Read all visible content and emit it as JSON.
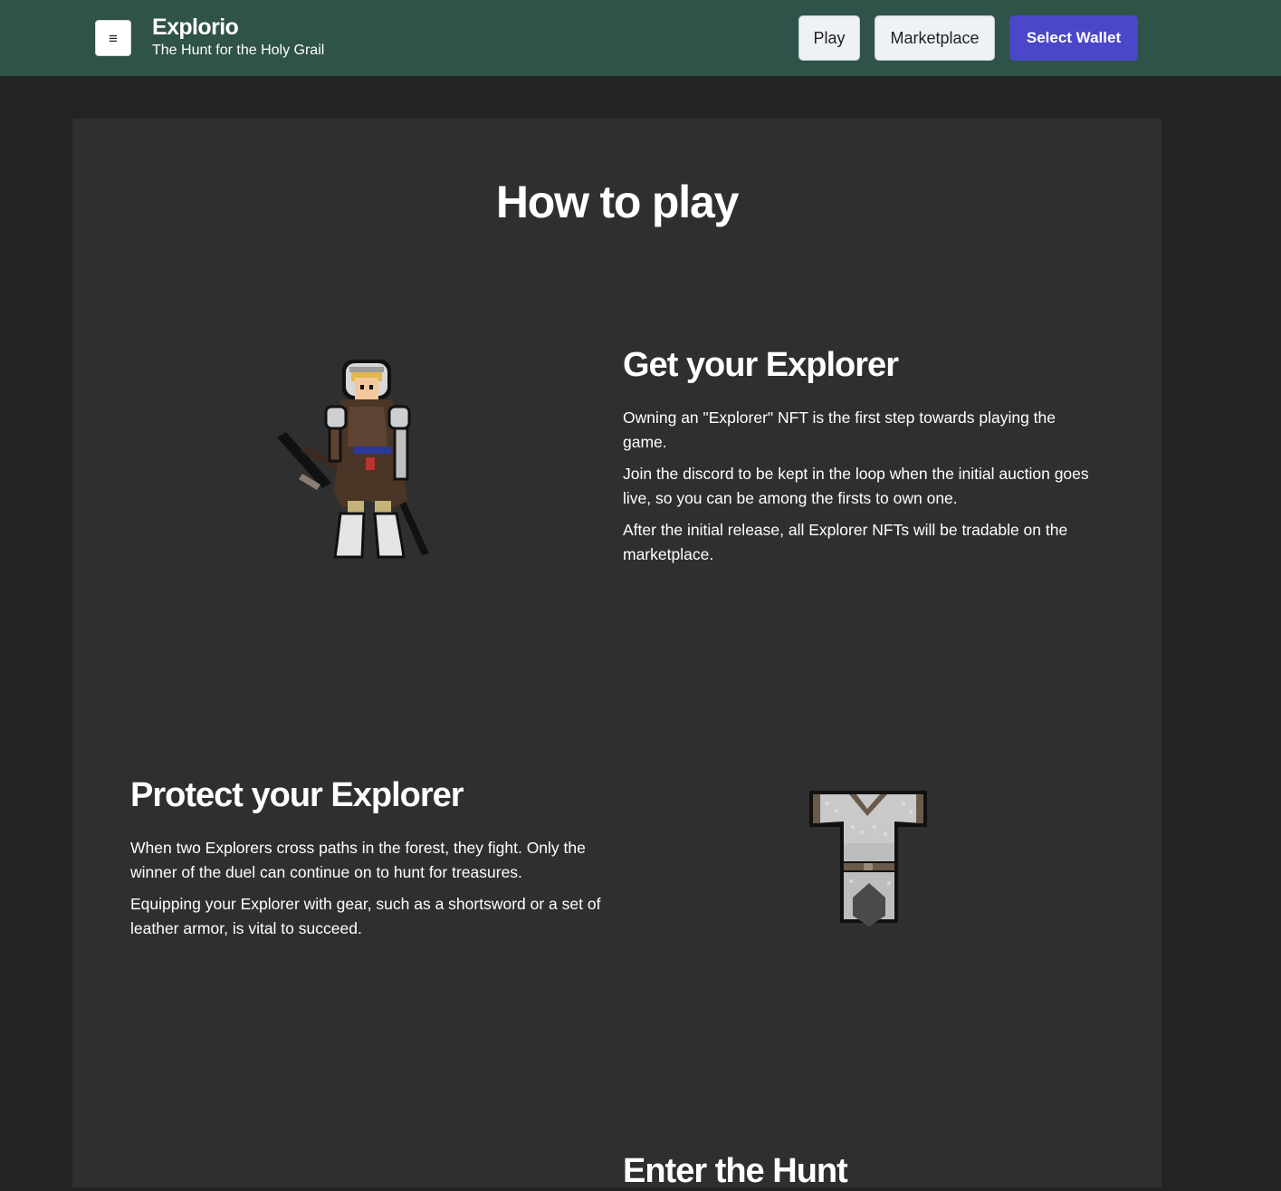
{
  "header": {
    "menu_icon": "hamburger-icon",
    "app_name": "Explorio",
    "tagline": "The Hunt for the Holy Grail",
    "play_label": "Play",
    "marketplace_label": "Marketplace",
    "wallet_label": "Select Wallet"
  },
  "main": {
    "title": "How to play",
    "sections": [
      {
        "heading": "Get your Explorer",
        "paragraphs": [
          "Owning an \"Explorer\" NFT is the first step towards playing the game.",
          "Join the discord to be kept in the loop when the initial auction goes live, so you can be among the firsts to own one.",
          "After the initial release, all Explorer NFTs will be tradable on the marketplace."
        ],
        "image": "explorer-knight-sprite"
      },
      {
        "heading": "Protect your Explorer",
        "paragraphs": [
          "When two Explorers cross paths in the forest, they fight. Only the winner of the duel can continue on to hunt for treasures.",
          "Equipping your Explorer with gear, such as a shortsword or a set of leather armor, is vital to succeed."
        ],
        "image": "chainmail-armor-sprite"
      },
      {
        "heading": "Enter the Hunt"
      }
    ]
  },
  "colors": {
    "header_bg": "#2f5249",
    "page_bg": "#232323",
    "card_bg": "#2f2f2f",
    "wallet_button": "#4a47c9",
    "light_button": "#eef1f5"
  }
}
